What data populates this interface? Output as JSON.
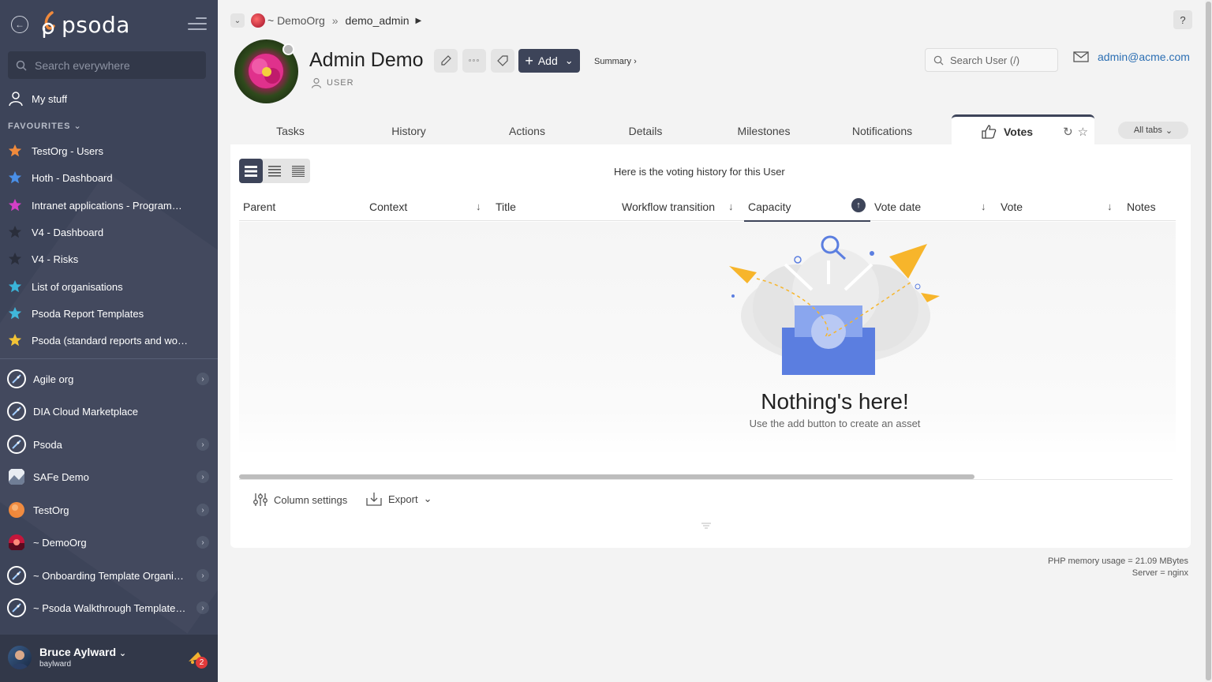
{
  "app": {
    "brand": "psoda"
  },
  "sidebar": {
    "search_placeholder": "Search everywhere",
    "my_stuff": "My stuff",
    "favourites_label": "FAVOURITES",
    "favourites": [
      {
        "label": "TestOrg - Users",
        "color": "#f08a3c"
      },
      {
        "label": "Hoth - Dashboard",
        "color": "#4a8fe7"
      },
      {
        "label": "Intranet applications - Programme...",
        "color": "#d43fc6"
      },
      {
        "label": "V4 - Dashboard",
        "color": "#2a2e3b"
      },
      {
        "label": "V4 - Risks",
        "color": "#2a2e3b"
      },
      {
        "label": "List of organisations",
        "color": "#3ab5d9"
      },
      {
        "label": "Psoda Report Templates",
        "color": "#3ab5d9"
      },
      {
        "label": "Psoda (standard reports and work...",
        "color": "#f2c230"
      }
    ],
    "orgs": [
      {
        "label": "Agile org",
        "icon": "rocket-icon",
        "has_children": true
      },
      {
        "label": "DIA Cloud Marketplace",
        "icon": "rocket-icon",
        "has_children": false
      },
      {
        "label": "Psoda",
        "icon": "rocket-icon",
        "has_children": true
      },
      {
        "label": "SAFe Demo",
        "icon": "landscape-icon",
        "has_children": true
      },
      {
        "label": "TestOrg",
        "icon": "orange-ball-icon",
        "has_children": true
      },
      {
        "label": "~ DemoOrg",
        "icon": "sunset-icon",
        "has_children": true
      },
      {
        "label": "~ Onboarding Template Organisa...",
        "icon": "rocket-icon",
        "has_children": true
      },
      {
        "label": "~ Psoda Walkthrough Template P...",
        "icon": "rocket-icon",
        "has_children": true
      }
    ],
    "user": {
      "name": "Bruce Aylward",
      "login": "baylward",
      "notifications": "2"
    }
  },
  "breadcrumb": {
    "org": "~ DemoOrg",
    "separator": "»",
    "item": "demo_admin"
  },
  "help_label": "?",
  "header": {
    "title": "Admin Demo",
    "type": "USER",
    "add_label": "Add",
    "summary_label": "Summary ›",
    "search_placeholder": "Search User (/)",
    "email": "admin@acme.com"
  },
  "tabs": [
    {
      "label": "Tasks"
    },
    {
      "label": "History"
    },
    {
      "label": "Actions"
    },
    {
      "label": "Details"
    },
    {
      "label": "Milestones"
    },
    {
      "label": "Notifications"
    }
  ],
  "active_tab": "Votes",
  "all_tabs_label": "All tabs",
  "card": {
    "info": "Here is the voting history for this User",
    "columns": [
      "Parent",
      "Context",
      "Title",
      "Workflow transition",
      "Capacity",
      "Vote date",
      "Vote",
      "Notes"
    ],
    "empty_title": "Nothing's here!",
    "empty_subtitle": "Use the add button to create an asset",
    "column_settings": "Column settings",
    "export": "Export"
  },
  "footer": {
    "memory": "PHP memory usage = 21.09 MBytes",
    "server": "Server = nginx"
  },
  "colors": {
    "sidebar": "#3d4459",
    "accent": "#3d4459",
    "link": "#2c6fb3"
  }
}
